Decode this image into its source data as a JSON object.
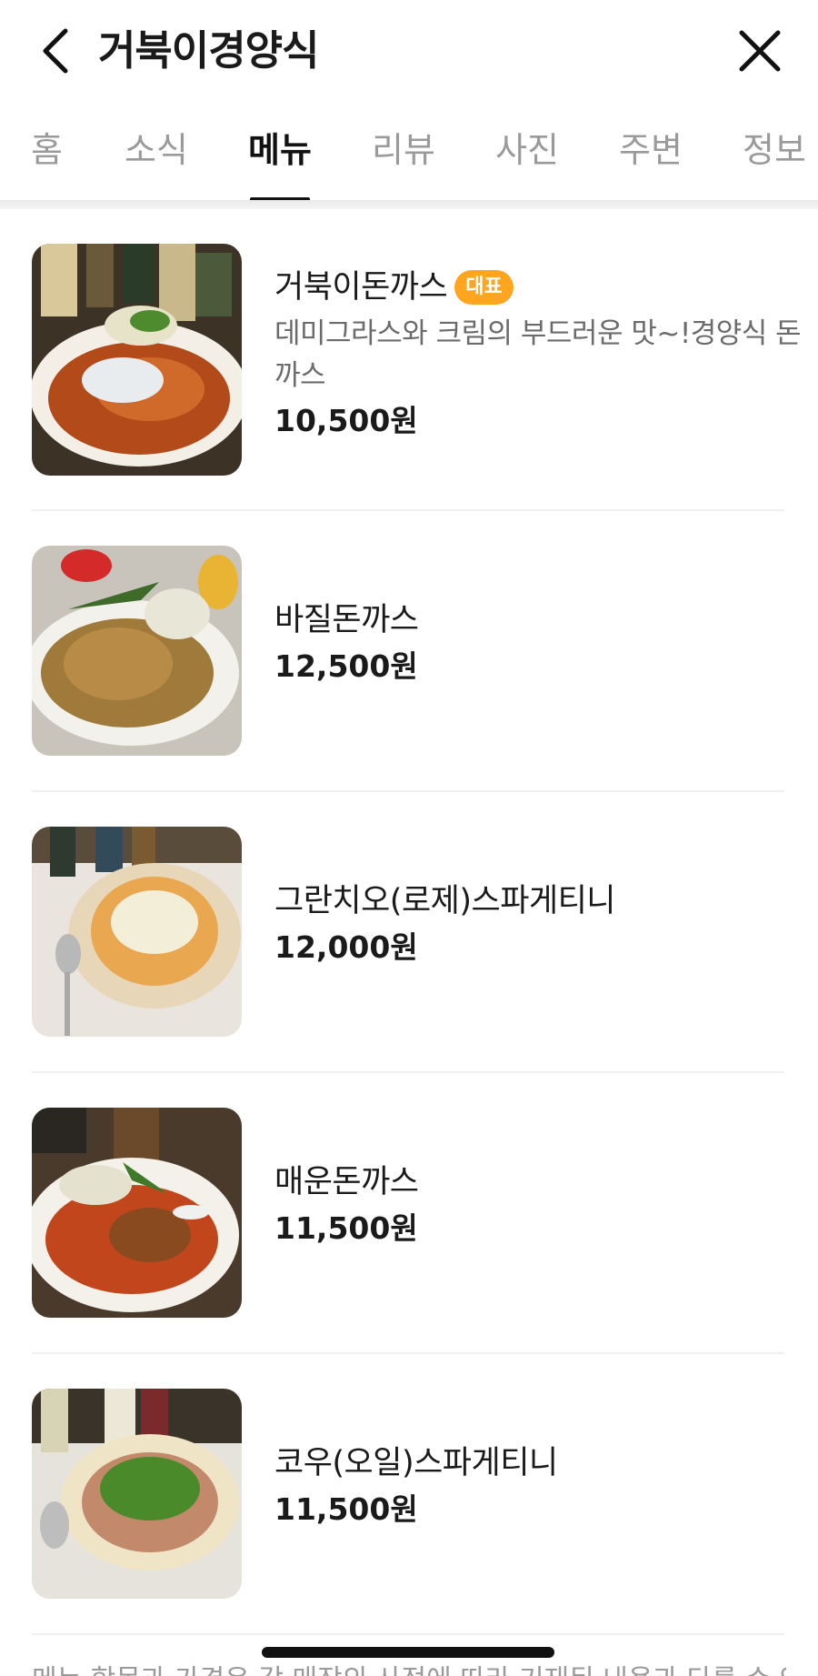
{
  "header": {
    "title": "거북이경양식"
  },
  "tabs": [
    {
      "label": "홈",
      "active": false
    },
    {
      "label": "소식",
      "active": false
    },
    {
      "label": "메뉴",
      "active": true
    },
    {
      "label": "리뷰",
      "active": false
    },
    {
      "label": "사진",
      "active": false
    },
    {
      "label": "주변",
      "active": false
    },
    {
      "label": "정보",
      "active": false
    }
  ],
  "menu": [
    {
      "name": "거북이돈까스",
      "badge": "대표",
      "description": "데미그라스와 크림의 부드러운 맛~!경양식 돈까스",
      "price": "10,500원",
      "image": "cutlet-demiglace-cream"
    },
    {
      "name": "바질돈까스",
      "price": "12,500원",
      "image": "cutlet-basil"
    },
    {
      "name": "그란치오(로제)스파게티니",
      "price": "12,000원",
      "image": "gratin-rose-pasta"
    },
    {
      "name": "매운돈까스",
      "price": "11,500원",
      "image": "cutlet-spicy"
    },
    {
      "name": "코우(오일)스파게티니",
      "price": "11,500원",
      "image": "oil-pasta-arugula"
    }
  ],
  "footnote": "메뉴 항목과 가격은 각 매장의 사정에 따라 기재된 내용과 다를 수 있",
  "colors": {
    "badge": "#ffa51f",
    "active_tab": "#111111",
    "inactive_tab": "#9a9a9a"
  },
  "icons": {
    "back": "chevron-left-icon",
    "close": "close-icon"
  }
}
